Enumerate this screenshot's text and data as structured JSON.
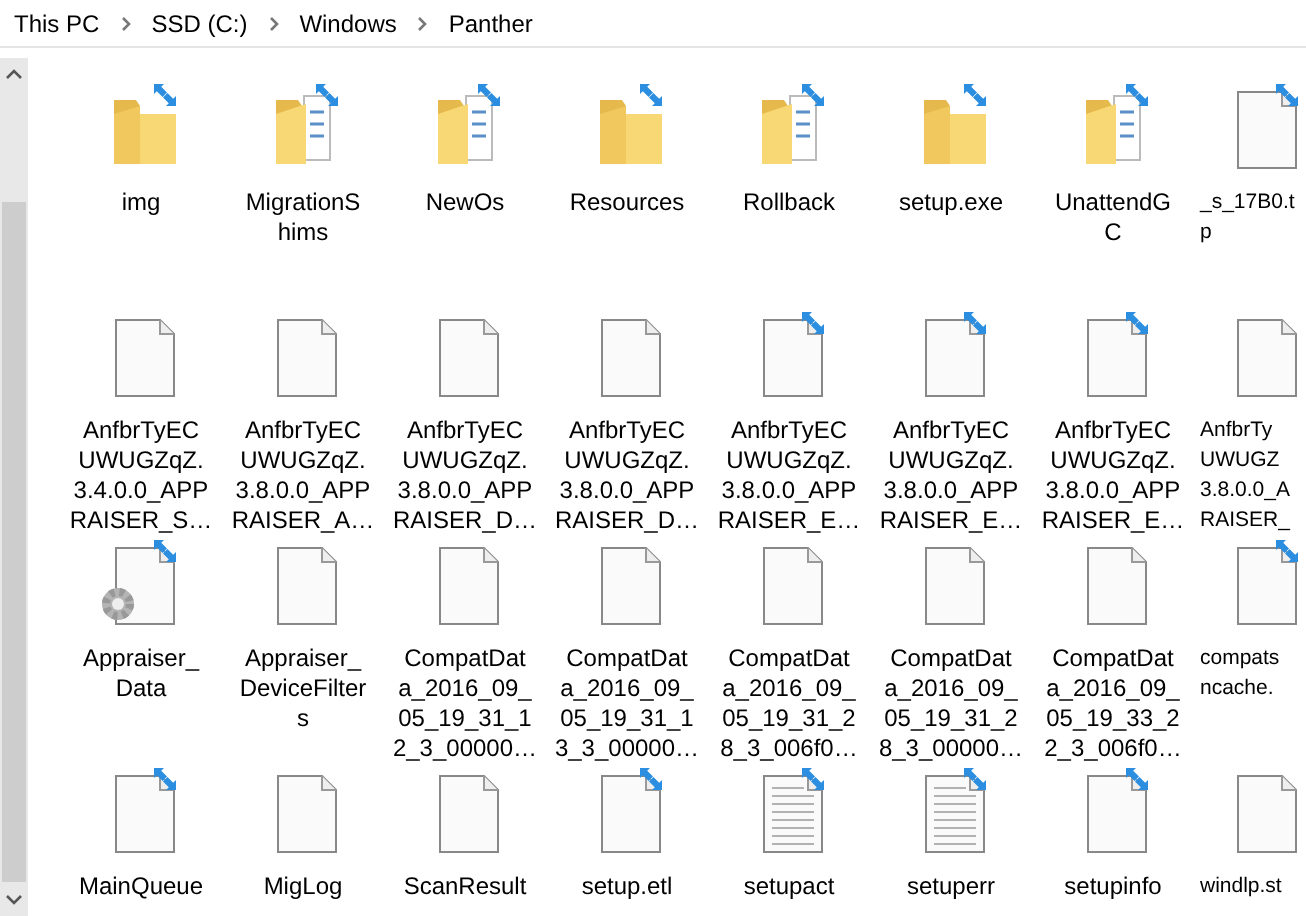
{
  "breadcrumb": [
    "This PC",
    "SSD (C:)",
    "Windows",
    "Panther"
  ],
  "items": [
    {
      "kind": "folder",
      "compressed": true,
      "lines": [
        "img"
      ]
    },
    {
      "kind": "folder-docs",
      "compressed": true,
      "lines": [
        "MigrationS",
        "hims"
      ]
    },
    {
      "kind": "folder-docs",
      "compressed": true,
      "lines": [
        "NewOs"
      ]
    },
    {
      "kind": "folder",
      "compressed": true,
      "lines": [
        "Resources"
      ]
    },
    {
      "kind": "folder-docs",
      "compressed": true,
      "lines": [
        "Rollback"
      ]
    },
    {
      "kind": "folder",
      "compressed": true,
      "lines": [
        "setup.exe"
      ]
    },
    {
      "kind": "folder-docs",
      "compressed": true,
      "lines": [
        "UnattendG",
        "C"
      ]
    },
    {
      "kind": "file",
      "compressed": true,
      "cut": true,
      "lines": [
        "_s_17B0.t",
        "p"
      ]
    },
    {
      "kind": "file",
      "compressed": false,
      "lines": [
        "AnfbrTyEC",
        "UWUGZqZ.",
        "3.4.0.0_APP",
        "RAISER_S…"
      ]
    },
    {
      "kind": "file",
      "compressed": false,
      "lines": [
        "AnfbrTyEC",
        "UWUGZqZ.",
        "3.8.0.0_APP",
        "RAISER_A…"
      ]
    },
    {
      "kind": "file",
      "compressed": false,
      "lines": [
        "AnfbrTyEC",
        "UWUGZqZ.",
        "3.8.0.0_APP",
        "RAISER_D…"
      ]
    },
    {
      "kind": "file",
      "compressed": false,
      "lines": [
        "AnfbrTyEC",
        "UWUGZqZ.",
        "3.8.0.0_APP",
        "RAISER_D…"
      ]
    },
    {
      "kind": "file",
      "compressed": true,
      "lines": [
        "AnfbrTyEC",
        "UWUGZqZ.",
        "3.8.0.0_APP",
        "RAISER_E…"
      ]
    },
    {
      "kind": "file",
      "compressed": true,
      "lines": [
        "AnfbrTyEC",
        "UWUGZqZ.",
        "3.8.0.0_APP",
        "RAISER_E…"
      ]
    },
    {
      "kind": "file",
      "compressed": true,
      "lines": [
        "AnfbrTyEC",
        "UWUGZqZ.",
        "3.8.0.0_APP",
        "RAISER_E…"
      ]
    },
    {
      "kind": "file",
      "compressed": false,
      "cut": true,
      "lines": [
        "AnfbrTy",
        "UWUGZ",
        "3.8.0.0_A",
        "RAISER_"
      ]
    },
    {
      "kind": "file-gear",
      "compressed": true,
      "lines": [
        "Appraiser_",
        "Data"
      ]
    },
    {
      "kind": "file",
      "compressed": false,
      "lines": [
        "Appraiser_",
        "DeviceFilter",
        "s"
      ]
    },
    {
      "kind": "file",
      "compressed": false,
      "lines": [
        "CompatDat",
        "a_2016_09_",
        "05_19_31_1",
        "2_3_00000…"
      ]
    },
    {
      "kind": "file",
      "compressed": false,
      "lines": [
        "CompatDat",
        "a_2016_09_",
        "05_19_31_1",
        "3_3_00000…"
      ]
    },
    {
      "kind": "file",
      "compressed": false,
      "lines": [
        "CompatDat",
        "a_2016_09_",
        "05_19_31_2",
        "8_3_006f0…"
      ]
    },
    {
      "kind": "file",
      "compressed": false,
      "lines": [
        "CompatDat",
        "a_2016_09_",
        "05_19_31_2",
        "8_3_00000…"
      ]
    },
    {
      "kind": "file",
      "compressed": false,
      "lines": [
        "CompatDat",
        "a_2016_09_",
        "05_19_33_2",
        "2_3_006f0…"
      ]
    },
    {
      "kind": "file",
      "compressed": true,
      "cut": true,
      "lines": [
        "compats",
        "ncache."
      ]
    },
    {
      "kind": "file",
      "compressed": true,
      "lines": [
        "MainQueue"
      ]
    },
    {
      "kind": "file",
      "compressed": false,
      "lines": [
        "MigLog"
      ]
    },
    {
      "kind": "file",
      "compressed": false,
      "lines": [
        "ScanResult"
      ]
    },
    {
      "kind": "file",
      "compressed": true,
      "lines": [
        "setup.etl"
      ]
    },
    {
      "kind": "file-text",
      "compressed": true,
      "lines": [
        "setupact"
      ]
    },
    {
      "kind": "file-text",
      "compressed": true,
      "lines": [
        "setuperr"
      ]
    },
    {
      "kind": "file",
      "compressed": true,
      "lines": [
        "setupinfo"
      ]
    },
    {
      "kind": "file",
      "compressed": false,
      "cut": true,
      "lines": [
        "windlp.st"
      ]
    }
  ]
}
